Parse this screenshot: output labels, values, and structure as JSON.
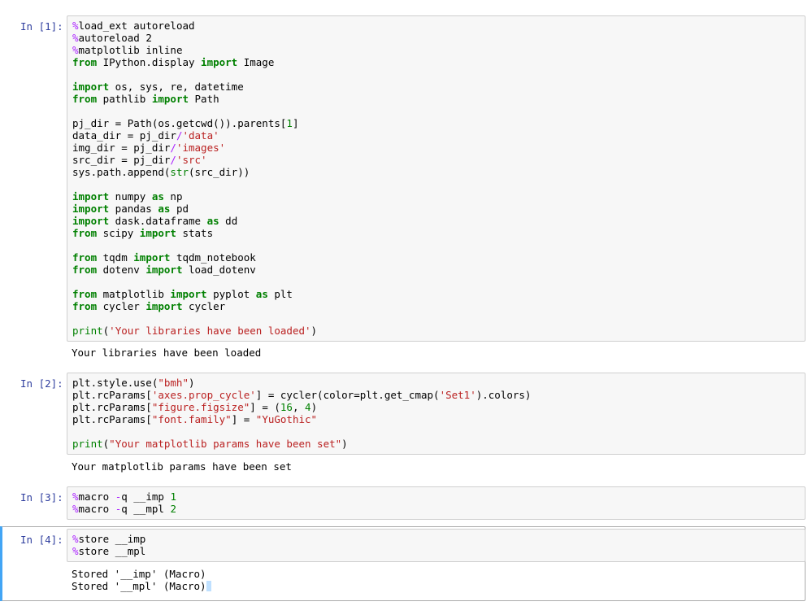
{
  "cells": [
    {
      "prompt": "In [1]:",
      "lines": [
        [
          [
            "mg",
            "%"
          ],
          [
            "t",
            "load_ext autoreload"
          ]
        ],
        [
          [
            "mg",
            "%"
          ],
          [
            "t",
            "autoreload 2"
          ]
        ],
        [
          [
            "mg",
            "%"
          ],
          [
            "t",
            "matplotlib inline"
          ]
        ],
        [
          [
            "kw",
            "from"
          ],
          [
            "t",
            " IPython.display "
          ],
          [
            "kw",
            "import"
          ],
          [
            "t",
            " Image"
          ]
        ],
        [],
        [
          [
            "kw",
            "import"
          ],
          [
            "t",
            " os, sys, re, datetime"
          ]
        ],
        [
          [
            "kw",
            "from"
          ],
          [
            "t",
            " pathlib "
          ],
          [
            "kw",
            "import"
          ],
          [
            "t",
            " Path"
          ]
        ],
        [],
        [
          [
            "t",
            "pj_dir = Path(os.getcwd()).parents["
          ],
          [
            "nm",
            "1"
          ],
          [
            "t",
            "]"
          ]
        ],
        [
          [
            "t",
            "data_dir = pj_dir"
          ],
          [
            "op",
            "/"
          ],
          [
            "st",
            "'data'"
          ]
        ],
        [
          [
            "t",
            "img_dir = pj_dir"
          ],
          [
            "op",
            "/"
          ],
          [
            "st",
            "'images'"
          ]
        ],
        [
          [
            "t",
            "src_dir = pj_dir"
          ],
          [
            "op",
            "/"
          ],
          [
            "st",
            "'src'"
          ]
        ],
        [
          [
            "t",
            "sys.path.append("
          ],
          [
            "bi",
            "str"
          ],
          [
            "t",
            "(src_dir))"
          ]
        ],
        [],
        [
          [
            "kw",
            "import"
          ],
          [
            "t",
            " numpy "
          ],
          [
            "kw",
            "as"
          ],
          [
            "t",
            " np"
          ]
        ],
        [
          [
            "kw",
            "import"
          ],
          [
            "t",
            " pandas "
          ],
          [
            "kw",
            "as"
          ],
          [
            "t",
            " pd"
          ]
        ],
        [
          [
            "kw",
            "import"
          ],
          [
            "t",
            " dask.dataframe "
          ],
          [
            "kw",
            "as"
          ],
          [
            "t",
            " dd"
          ]
        ],
        [
          [
            "kw",
            "from"
          ],
          [
            "t",
            " scipy "
          ],
          [
            "kw",
            "import"
          ],
          [
            "t",
            " stats"
          ]
        ],
        [],
        [
          [
            "kw",
            "from"
          ],
          [
            "t",
            " tqdm "
          ],
          [
            "kw",
            "import"
          ],
          [
            "t",
            " tqdm_notebook"
          ]
        ],
        [
          [
            "kw",
            "from"
          ],
          [
            "t",
            " dotenv "
          ],
          [
            "kw",
            "import"
          ],
          [
            "t",
            " load_dotenv"
          ]
        ],
        [],
        [
          [
            "kw",
            "from"
          ],
          [
            "t",
            " matplotlib "
          ],
          [
            "kw",
            "import"
          ],
          [
            "t",
            " pyplot "
          ],
          [
            "kw",
            "as"
          ],
          [
            "t",
            " plt"
          ]
        ],
        [
          [
            "kw",
            "from"
          ],
          [
            "t",
            " cycler "
          ],
          [
            "kw",
            "import"
          ],
          [
            "t",
            " cycler"
          ]
        ],
        [],
        [
          [
            "bi",
            "print"
          ],
          [
            "t",
            "("
          ],
          [
            "st",
            "'Your libraries have been loaded'"
          ],
          [
            "t",
            ")"
          ]
        ]
      ],
      "output": [
        "Your libraries have been loaded"
      ]
    },
    {
      "prompt": "In [2]:",
      "lines": [
        [
          [
            "t",
            "plt.style.use("
          ],
          [
            "st",
            "\"bmh\""
          ],
          [
            "t",
            ")"
          ]
        ],
        [
          [
            "t",
            "plt.rcParams["
          ],
          [
            "st",
            "'axes.prop_cycle'"
          ],
          [
            "t",
            "] = cycler(color=plt.get_cmap("
          ],
          [
            "st",
            "'Set1'"
          ],
          [
            "t",
            ").colors)"
          ]
        ],
        [
          [
            "t",
            "plt.rcParams["
          ],
          [
            "st",
            "\"figure.figsize\""
          ],
          [
            "t",
            "] = ("
          ],
          [
            "nm",
            "16"
          ],
          [
            "t",
            ", "
          ],
          [
            "nm",
            "4"
          ],
          [
            "t",
            ")"
          ]
        ],
        [
          [
            "t",
            "plt.rcParams["
          ],
          [
            "st",
            "\"font.family\""
          ],
          [
            "t",
            "] = "
          ],
          [
            "st",
            "\"YuGothic\""
          ]
        ],
        [],
        [
          [
            "bi",
            "print"
          ],
          [
            "t",
            "("
          ],
          [
            "st",
            "\"Your matplotlib params have been set\""
          ],
          [
            "t",
            ")"
          ]
        ]
      ],
      "output": [
        "Your matplotlib params have been set"
      ]
    },
    {
      "prompt": "In [3]:",
      "lines": [
        [
          [
            "mg",
            "%"
          ],
          [
            "t",
            "macro "
          ],
          [
            "op",
            "-"
          ],
          [
            "t",
            "q __imp "
          ],
          [
            "nm",
            "1"
          ]
        ],
        [
          [
            "mg",
            "%"
          ],
          [
            "t",
            "macro "
          ],
          [
            "op",
            "-"
          ],
          [
            "t",
            "q __mpl "
          ],
          [
            "nm",
            "2"
          ]
        ]
      ],
      "output": []
    },
    {
      "prompt": "In [4]:",
      "lines": [
        [
          [
            "mg",
            "%"
          ],
          [
            "t",
            "store __imp"
          ]
        ],
        [
          [
            "mg",
            "%"
          ],
          [
            "t",
            "store __mpl"
          ]
        ]
      ],
      "output": [
        "Stored '__imp' (Macro)",
        "Stored '__mpl' (Macro)"
      ]
    }
  ]
}
